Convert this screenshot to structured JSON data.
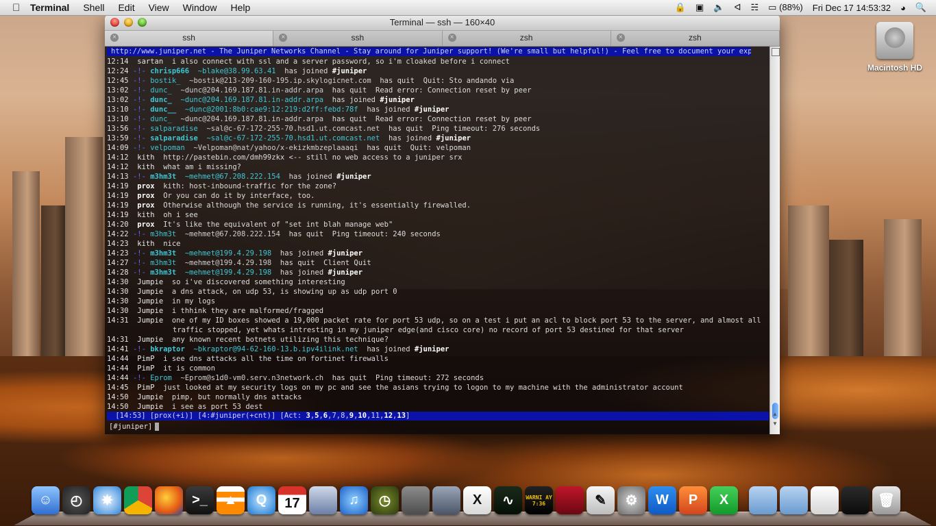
{
  "menubar": {
    "app_name": "Terminal",
    "items": [
      "Shell",
      "Edit",
      "View",
      "Window",
      "Help"
    ],
    "battery": "(88%)",
    "clock": "Fri Dec 17  14:53:32"
  },
  "desktop": {
    "hd_label": "Macintosh HD"
  },
  "window": {
    "title": "Terminal — ssh — 160×40",
    "tabs": [
      "ssh",
      "ssh",
      "zsh",
      "zsh"
    ]
  },
  "terminal": {
    "topic": "http://www.juniper.net - The Juniper Networks Channel - Stay around for Juniper support! (We're small but helpful!) - Feel free to document your experiences ht",
    "lines": [
      {
        "t": "12:14",
        "nick": "sartan",
        "msg": "i also connect with ssl and a server password, so i'm cloaked before i connect"
      },
      {
        "t": "12:24",
        "mark": "-!-",
        "nick": "chrisp666",
        "host": "~blake@38.99.63.41",
        "action": "has joined",
        "chan": "#juniper",
        "style": "join"
      },
      {
        "t": "12:45",
        "mark": "-!-",
        "nick": "bostik_",
        "host": "~bostik@213-209-160-195.ip.skylogicnet.com",
        "action": "has quit",
        "reason": "Quit: Sto andando via",
        "style": "quit"
      },
      {
        "t": "13:02",
        "mark": "-!-",
        "nick": "dunc_",
        "host": "~dunc@204.169.187.81.in-addr.arpa",
        "action": "has quit",
        "reason": "Read error: Connection reset by peer",
        "style": "quit"
      },
      {
        "t": "13:02",
        "mark": "-!-",
        "nick": "dunc_",
        "host": "~dunc@204.169.187.81.in-addr.arpa",
        "action": "has joined",
        "chan": "#juniper",
        "style": "join"
      },
      {
        "t": "13:10",
        "mark": "-!-",
        "nick": "dunc__",
        "host": "~dunc@2001:8b0:cae9:12:219:d2ff:febd:78f",
        "action": "has joined",
        "chan": "#juniper",
        "style": "join"
      },
      {
        "t": "13:10",
        "mark": "-!-",
        "nick": "dunc_",
        "host": "~dunc@204.169.187.81.in-addr.arpa",
        "action": "has quit",
        "reason": "Read error: Connection reset by peer",
        "style": "quit"
      },
      {
        "t": "13:56",
        "mark": "-!-",
        "nick": "salparadise",
        "host": "~sal@c-67-172-255-70.hsd1.ut.comcast.net",
        "action": "has quit",
        "reason": "Ping timeout: 276 seconds",
        "style": "quit"
      },
      {
        "t": "13:59",
        "mark": "-!-",
        "nick": "salparadise",
        "host": "~sal@c-67-172-255-70.hsd1.ut.comcast.net",
        "action": "has joined",
        "chan": "#juniper",
        "style": "join"
      },
      {
        "t": "14:09",
        "mark": "-!-",
        "nick": "velpoman",
        "host": "~Velpoman@nat/yahoo/x-ekizkmbzeplaaaqi",
        "action": "has quit",
        "reason": "Quit: velpoman",
        "style": "quit"
      },
      {
        "t": "14:12",
        "nick": "kith",
        "msg": "http://pastebin.com/dmh99zkx <-- still no web access to a juniper srx"
      },
      {
        "t": "14:12",
        "nick": "kith",
        "msg": "what am i missing?"
      },
      {
        "t": "14:13",
        "mark": "-!-",
        "nick": "m3hm3t",
        "host": "~mehmet@67.208.222.154",
        "action": "has joined",
        "chan": "#juniper",
        "style": "join2"
      },
      {
        "t": "14:19",
        "nick": "prox",
        "msg": "kith: host-inbound-traffic for the zone?",
        "bold": true
      },
      {
        "t": "14:19",
        "nick": "prox",
        "msg": "Or you can do it by interface, too.",
        "bold": true
      },
      {
        "t": "14:19",
        "nick": "prox",
        "msg": "Otherwise although the service is running, it's essentially firewalled.",
        "bold": true
      },
      {
        "t": "14:19",
        "nick": "kith",
        "msg": "oh i see"
      },
      {
        "t": "14:20",
        "nick": "prox",
        "msg": "It's like the equivalent of \"set int blah manage web\"",
        "bold": true
      },
      {
        "t": "14:22",
        "mark": "-!-",
        "nick": "m3hm3t",
        "host": "~mehmet@67.208.222.154",
        "action": "has quit",
        "reason": "Ping timeout: 240 seconds",
        "style": "quit2"
      },
      {
        "t": "14:23",
        "nick": "kith",
        "msg": "nice"
      },
      {
        "t": "14:23",
        "mark": "-!-",
        "nick": "m3hm3t",
        "host": "~mehmet@199.4.29.198",
        "action": "has joined",
        "chan": "#juniper",
        "style": "join2"
      },
      {
        "t": "14:27",
        "mark": "-!-",
        "nick": "m3hm3t",
        "host": "~mehmet@199.4.29.198",
        "action": "has quit",
        "reason": "Client Quit",
        "style": "quit2"
      },
      {
        "t": "14:28",
        "mark": "-!-",
        "nick": "m3hm3t",
        "host": "~mehmet@199.4.29.198",
        "action": "has joined",
        "chan": "#juniper",
        "style": "join2"
      },
      {
        "t": "14:30",
        "nick": "Jumpie",
        "msg": "so i've discovered something interesting"
      },
      {
        "t": "14:30",
        "nick": "Jumpie",
        "msg": "a dns attack, on udp 53, is showing up as udp port 0"
      },
      {
        "t": "14:30",
        "nick": "Jumpie",
        "msg": "in my logs"
      },
      {
        "t": "14:30",
        "nick": "Jumpie",
        "msg": "i thhink they are malformed/fragged"
      },
      {
        "t": "14:31",
        "nick": "Jumpie",
        "msg": "one of my ID boxes showed a 19,000 packet rate for port 53 udp, so on a test i put an acl to block port 53 to the server, and almost all the"
      },
      {
        "cont": "traffic stopped, yet whats intresting in my juniper edge(and cisco core) no record of port 53 destined for that server"
      },
      {
        "t": "14:31",
        "nick": "Jumpie",
        "msg": "any known recent botnets utilizing this technique?"
      },
      {
        "t": "14:41",
        "mark": "-!-",
        "nick": "bkraptor",
        "host": "~bkraptor@94-62-160-13.b.ipv4ilink.net",
        "action": "has joined",
        "chan": "#juniper",
        "style": "join"
      },
      {
        "t": "14:44",
        "nick": "PimP",
        "msg": "i see dns attacks all the time on fortinet firewalls"
      },
      {
        "t": "14:44",
        "nick": "PimP",
        "msg": "it is common"
      },
      {
        "t": "14:44",
        "mark": "-!-",
        "nick": "Eprom",
        "host": "~Eprom@s1d0-vm0.serv.n3network.ch",
        "action": "has quit",
        "reason": "Ping timeout: 272 seconds",
        "style": "quit"
      },
      {
        "t": "14:45",
        "nick": "PimP",
        "msg": "just looked at my security logs on my pc and see the asians trying to logon to my machine with the administrator account"
      },
      {
        "t": "14:50",
        "nick": "Jumpie",
        "msg": "pimp, but normally dns attacks"
      },
      {
        "t": "14:50",
        "nick": "Jumpie",
        "msg": "i see as port 53 dest"
      }
    ],
    "status_pre": " [14:53] [prox(+i)] [4:#juniper(+cnt)] [Act: ",
    "status_acts": [
      "3",
      "5",
      "6",
      "7",
      "8",
      "9",
      "10",
      "11",
      "12",
      "13"
    ],
    "status_post": "]",
    "prompt": "[#juniper]"
  },
  "dock": {
    "icons": [
      "finder-icon",
      "dashboard-icon",
      "safari-icon",
      "chrome-icon",
      "firefox-icon",
      "terminal-icon",
      "vlc-icon",
      "quicktime-icon",
      "ical-icon",
      "preview-icon",
      "itunes-icon",
      "time-machine-icon",
      "vmware-icon",
      "vnc-icon",
      "x11-icon",
      "activity-monitor-icon",
      "console-icon",
      "photo-booth-icon",
      "textedit-icon",
      "system-preferences-icon",
      "word-icon",
      "powerpoint-icon",
      "excel-icon",
      "applications-folder-icon",
      "documents-folder-icon",
      "document-stack-icon",
      "terminal-stack-icon",
      "trash-icon"
    ],
    "ical_day": "17",
    "console_text": "WARNI AY 7:36"
  }
}
